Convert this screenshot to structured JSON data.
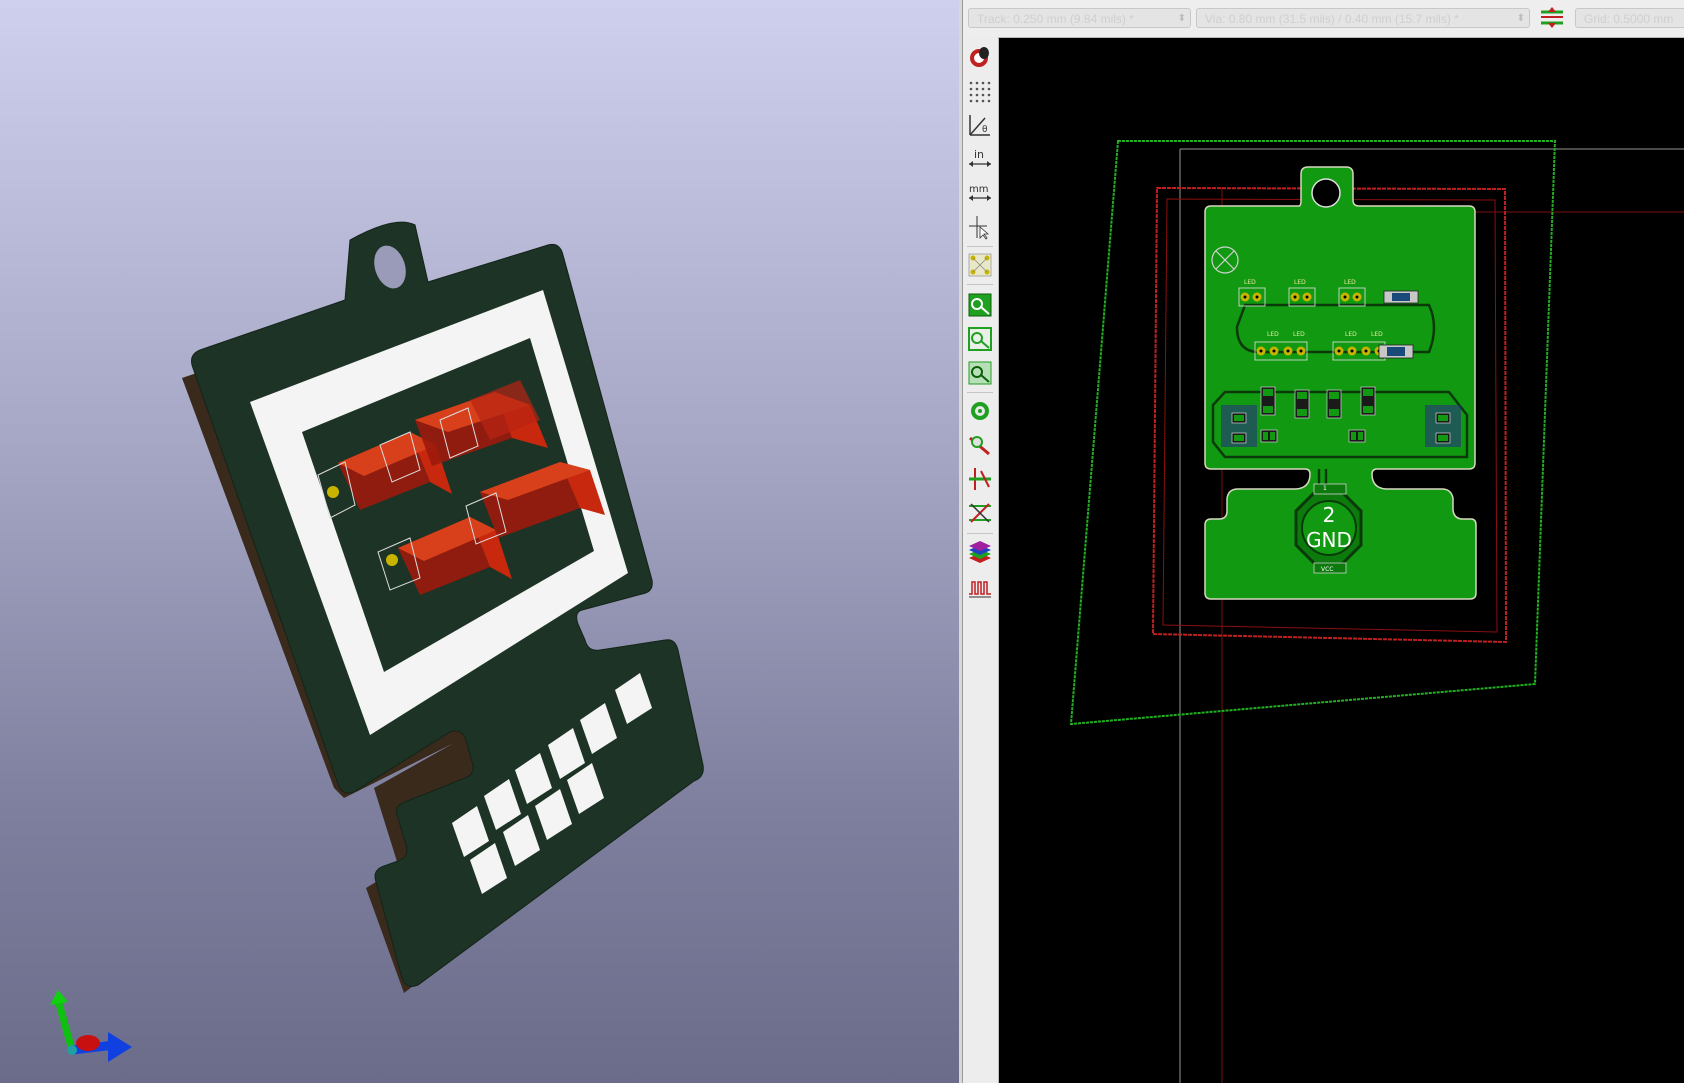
{
  "toolbar": {
    "track_select": "Track: 0.250 mm (9.84 mils) *",
    "via_select": "Via: 0.80 mm (31.5 mils) / 0.40 mm (15.7 mils) *",
    "grid_select": "Grid: 0.5000 mm"
  },
  "left_toolbar": {
    "inch_label": "in",
    "mm_label": "mm"
  },
  "board": {
    "gnd_pad_number": "2",
    "gnd_pad_net": "GND",
    "vcc_label": "VCC",
    "pad1_label": "1",
    "led_label": "LED"
  },
  "colors": {
    "board_green": "#119911",
    "copper_gold": "#c8b400",
    "courtyard_red": "#c02020",
    "edge_green": "#20b020",
    "viewer_bg_top": "#cfd0ee",
    "viewer_bg_bottom": "#6b6c8a",
    "soldermask_dark": "#1c3325",
    "led_red": "#b02010"
  }
}
